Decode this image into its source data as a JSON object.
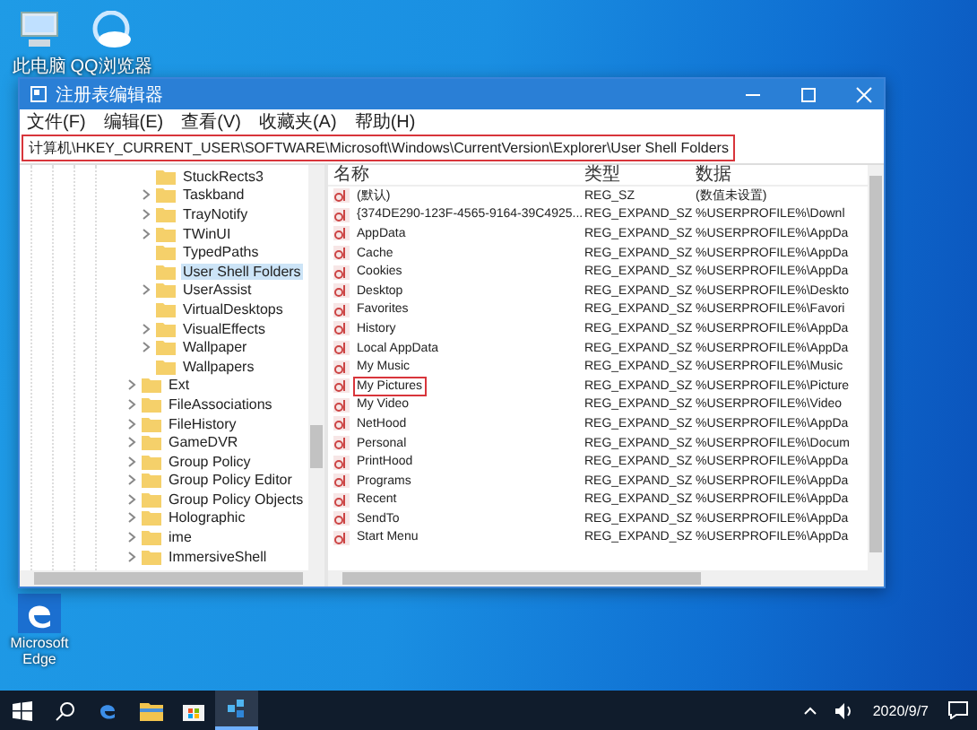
{
  "desktop_icons": [
    {
      "label": "此电脑",
      "kind": "pc"
    },
    {
      "label": "QQ浏览器",
      "kind": "cloud"
    },
    {
      "label": "Microsoft Edge",
      "kind": "edge"
    }
  ],
  "window": {
    "title": "注册表编辑器"
  },
  "menu": [
    "文件(F)",
    "编辑(E)",
    "查看(V)",
    "收藏夹(A)",
    "帮助(H)"
  ],
  "address": {
    "value": "计算机\\HKEY_CURRENT_USER\\SOFTWARE\\Microsoft\\Windows\\CurrentVersion\\Explorer\\User Shell Folders",
    "highlighted": true
  },
  "tree": {
    "subkeys": [
      {
        "label": "StuckRects3",
        "expandable": false,
        "selected": false
      },
      {
        "label": "Taskband",
        "expandable": true,
        "selected": false
      },
      {
        "label": "TrayNotify",
        "expandable": true,
        "selected": false
      },
      {
        "label": "TWinUI",
        "expandable": true,
        "selected": false
      },
      {
        "label": "TypedPaths",
        "expandable": false,
        "selected": false
      },
      {
        "label": "User Shell Folders",
        "expandable": false,
        "selected": true
      },
      {
        "label": "UserAssist",
        "expandable": true,
        "selected": false
      },
      {
        "label": "VirtualDesktops",
        "expandable": false,
        "selected": false
      },
      {
        "label": "VisualEffects",
        "expandable": true,
        "selected": false
      },
      {
        "label": "Wallpaper",
        "expandable": true,
        "selected": false
      },
      {
        "label": "Wallpapers",
        "expandable": false,
        "selected": false
      }
    ],
    "keys": [
      {
        "label": "Ext",
        "expandable": true,
        "selected": false
      },
      {
        "label": "FileAssociations",
        "expandable": true,
        "selected": false
      },
      {
        "label": "FileHistory",
        "expandable": true,
        "selected": false
      },
      {
        "label": "GameDVR",
        "expandable": true,
        "selected": false
      },
      {
        "label": "Group Policy",
        "expandable": true,
        "selected": false
      },
      {
        "label": "Group Policy Editor",
        "expandable": true,
        "selected": false
      },
      {
        "label": "Group Policy Objects",
        "expandable": true,
        "selected": false
      },
      {
        "label": "Holographic",
        "expandable": true,
        "selected": false
      },
      {
        "label": "ime",
        "expandable": true,
        "selected": false
      },
      {
        "label": "ImmersiveShell",
        "expandable": true,
        "selected": false
      }
    ]
  },
  "columns": [
    "名称",
    "类型",
    "数据"
  ],
  "values": [
    {
      "name": "(默认)",
      "type": "REG_SZ",
      "data": "(数值未设置)",
      "highlighted": false
    },
    {
      "name": "{374DE290-123F-4565-9164-39C4925...",
      "type": "REG_EXPAND_SZ",
      "data": "%USERPROFILE%\\Downl",
      "highlighted": false
    },
    {
      "name": "AppData",
      "type": "REG_EXPAND_SZ",
      "data": "%USERPROFILE%\\AppDa",
      "highlighted": false
    },
    {
      "name": "Cache",
      "type": "REG_EXPAND_SZ",
      "data": "%USERPROFILE%\\AppDa",
      "highlighted": false
    },
    {
      "name": "Cookies",
      "type": "REG_EXPAND_SZ",
      "data": "%USERPROFILE%\\AppDa",
      "highlighted": false
    },
    {
      "name": "Desktop",
      "type": "REG_EXPAND_SZ",
      "data": "%USERPROFILE%\\Deskto",
      "highlighted": false
    },
    {
      "name": "Favorites",
      "type": "REG_EXPAND_SZ",
      "data": "%USERPROFILE%\\Favori",
      "highlighted": false
    },
    {
      "name": "History",
      "type": "REG_EXPAND_SZ",
      "data": "%USERPROFILE%\\AppDa",
      "highlighted": false
    },
    {
      "name": "Local AppData",
      "type": "REG_EXPAND_SZ",
      "data": "%USERPROFILE%\\AppDa",
      "highlighted": false
    },
    {
      "name": "My Music",
      "type": "REG_EXPAND_SZ",
      "data": "%USERPROFILE%\\Music",
      "highlighted": false
    },
    {
      "name": "My Pictures",
      "type": "REG_EXPAND_SZ",
      "data": "%USERPROFILE%\\Picture",
      "highlighted": true
    },
    {
      "name": "My Video",
      "type": "REG_EXPAND_SZ",
      "data": "%USERPROFILE%\\Video",
      "highlighted": false
    },
    {
      "name": "NetHood",
      "type": "REG_EXPAND_SZ",
      "data": "%USERPROFILE%\\AppDa",
      "highlighted": false
    },
    {
      "name": "Personal",
      "type": "REG_EXPAND_SZ",
      "data": "%USERPROFILE%\\Docum",
      "highlighted": false
    },
    {
      "name": "PrintHood",
      "type": "REG_EXPAND_SZ",
      "data": "%USERPROFILE%\\AppDa",
      "highlighted": false
    },
    {
      "name": "Programs",
      "type": "REG_EXPAND_SZ",
      "data": "%USERPROFILE%\\AppDa",
      "highlighted": false
    },
    {
      "name": "Recent",
      "type": "REG_EXPAND_SZ",
      "data": "%USERPROFILE%\\AppDa",
      "highlighted": false
    },
    {
      "name": "SendTo",
      "type": "REG_EXPAND_SZ",
      "data": "%USERPROFILE%\\AppDa",
      "highlighted": false
    },
    {
      "name": "Start Menu",
      "type": "REG_EXPAND_SZ",
      "data": "%USERPROFILE%\\AppDa",
      "highlighted": false
    }
  ],
  "taskbar": {
    "apps": [
      {
        "kind": "start",
        "active": false
      },
      {
        "kind": "search",
        "active": false
      },
      {
        "kind": "edge",
        "active": false
      },
      {
        "kind": "folder",
        "active": false
      },
      {
        "kind": "store",
        "active": false
      },
      {
        "kind": "regedit",
        "active": true
      }
    ],
    "date": "2020/9/7"
  }
}
